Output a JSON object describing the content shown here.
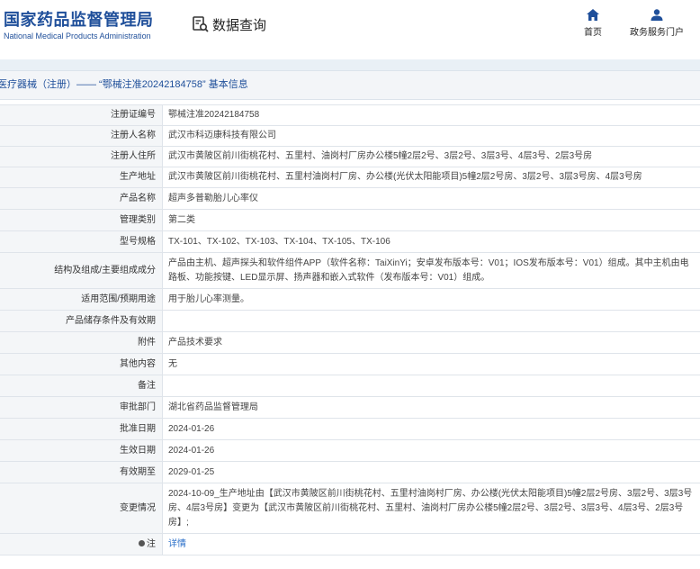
{
  "header": {
    "logo_cn": "国家药品监督管理局",
    "logo_en": "National Medical Products Administration",
    "query_label": "数据查询",
    "nav_home": "首页",
    "nav_gov": "政务服务门户"
  },
  "breadcrumb": "医疗器械（注册）—— “鄂械注准20242184758” 基本信息",
  "rows": [
    {
      "label": "注册证编号",
      "value": "鄂械注准20242184758"
    },
    {
      "label": "注册人名称",
      "value": "武汉市科迈康科技有限公司"
    },
    {
      "label": "注册人住所",
      "value": "武汉市黄陂区前川街桃花村、五里村、油岗村厂房办公楼5幢2层2号、3层2号、3层3号、4层3号、2层3号房"
    },
    {
      "label": "生产地址",
      "value": "武汉市黄陂区前川街桃花村、五里村油岗村厂房、办公楼(光伏太阳能项目)5幢2层2号房、3层2号、3层3号房、4层3号房"
    },
    {
      "label": "产品名称",
      "value": "超声多普勒胎儿心率仪"
    },
    {
      "label": "管理类别",
      "value": "第二类"
    },
    {
      "label": "型号规格",
      "value": "TX-101、TX-102、TX-103、TX-104、TX-105、TX-106"
    },
    {
      "label": "结构及组成/主要组成成分",
      "value": "产品由主机、超声探头和软件组件APP（软件名称：TaiXinYi；安卓发布版本号：V01；IOS发布版本号：V01）组成。其中主机由电路板、功能按键、LED显示屏、扬声器和嵌入式软件（发布版本号：V01）组成。"
    },
    {
      "label": "适用范围/预期用途",
      "value": "用于胎儿心率测量。"
    },
    {
      "label": "产品储存条件及有效期",
      "value": ""
    },
    {
      "label": "附件",
      "value": "产品技术要求"
    },
    {
      "label": "其他内容",
      "value": "无"
    },
    {
      "label": "备注",
      "value": ""
    },
    {
      "label": "审批部门",
      "value": "湖北省药品监督管理局"
    },
    {
      "label": "批准日期",
      "value": "2024-01-26"
    },
    {
      "label": "生效日期",
      "value": "2024-01-26"
    },
    {
      "label": "有效期至",
      "value": "2029-01-25"
    },
    {
      "label": "变更情况",
      "value": "2024-10-09_生产地址由【武汉市黄陂区前川街桃花村、五里村油岗村厂房、办公楼(光伏太阳能项目)5幢2层2号房、3层2号、3层3号房、4层3号房】变更为【武汉市黄陂区前川街桃花村、五里村、油岗村厂房办公楼5幢2层2号、3层2号、3层3号、4层3号、2层3号房】;"
    }
  ],
  "note_row": {
    "label": "注",
    "value": "详情"
  }
}
